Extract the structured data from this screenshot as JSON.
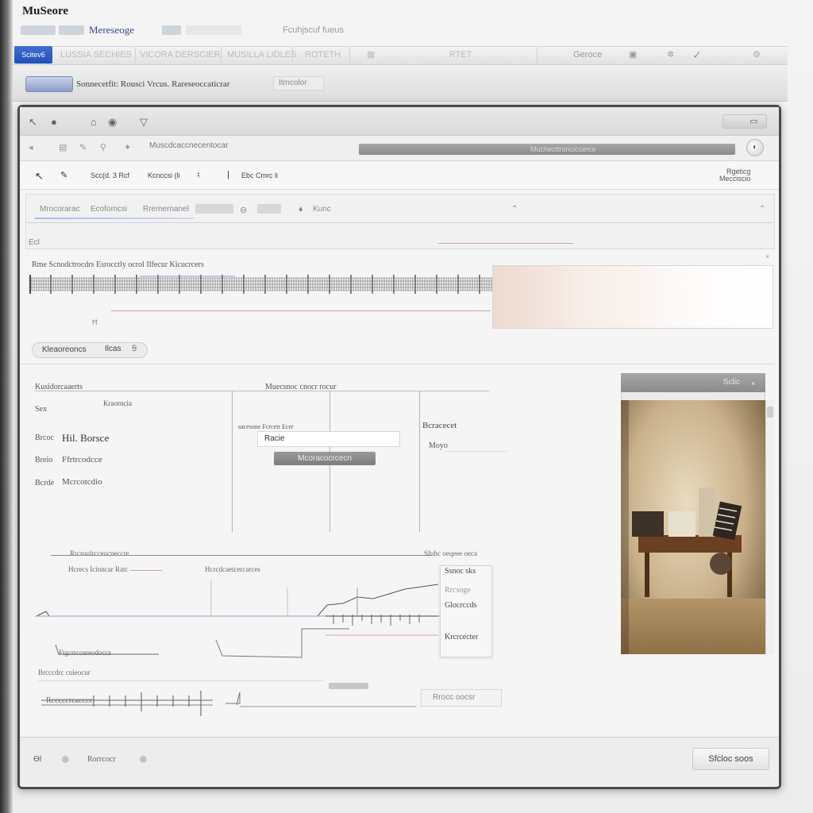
{
  "app": {
    "title": "MuSeore",
    "brand_link": "Mereseoge",
    "caption": "Fcuhjscuf fueus"
  },
  "main_toolbar": {
    "active_tab": "Scitev6",
    "items": [
      "LUSSIA SECHIES",
      "VICORA DERSCIER",
      "MUSILLA LIDLES",
      "ROTETH",
      "RTET",
      "Geroce"
    ]
  },
  "sub_toolbar": {
    "path": "Sonnecetfit: Rousci Vrcus. Rareseoccaticrar",
    "search": "Itmcolor"
  },
  "nav": {
    "url": "Muscdcaccnecentocar",
    "field": "Muchecttronciccerce",
    "go": "◐"
  },
  "format_bar": {
    "item1": "Scc(d. 3 Rcf",
    "item2": "Kcnccsi (li",
    "item3": "Ebc Cmrc li",
    "right_line1": "Rgeticg",
    "right_line2": "Mecciscio"
  },
  "score": {
    "tab1": "Mrocorarac",
    "tab2": "Ecofomcsi",
    "tab3": "Rremernanel",
    "tab4": "Kunc",
    "row_label": "Ecl",
    "measure_label": "Rme Scnodctrocdrs Esrocctly ocrol Ilfecur Kicucrcers",
    "tiny_note": "Ħ"
  },
  "measure_select": {
    "label": "Kleaoreoncs",
    "value": "Ilcas",
    "btn": "Ꞩ"
  },
  "properties": {
    "header": "Kusidorcaaerts",
    "row1_label": "Sex",
    "row1_hint": "Kraorncia",
    "row2_label": "Brcoc",
    "row2_value": "Hil. Borsce",
    "row3_label": "Breio",
    "row3_value": "Ffrtrcodcce",
    "row4_label": "Bcrde",
    "row4_value": "Mcrcotcdio",
    "col2_header": "Muecsnoc cnocr rocur",
    "col2_label": "sacesone Fcrcetr Ecre",
    "input_value": "Racie",
    "button": "Mcoracocrcecn",
    "col3_label": "Bcracecet",
    "col3_value": "Moyo"
  },
  "image_panel": {
    "header": "Sclic"
  },
  "lower": {
    "label1": "Rrcroolrcceocneccre",
    "label2": "Hcrecs Icinncar Ratc",
    "label3": "Hcrcdcaetcercarces",
    "label4": "Ftgcrrccereodoccs",
    "label5": "Brcccdrc cuieocur",
    "label6": "Rcccccrcaccce",
    "right_label": "Sfuhc oeqeee oeca",
    "field": "Rrocc oocsr",
    "popup": [
      "Ssnoc sks",
      "Rrcsoge",
      "Glocrccds",
      "Krcrcecter"
    ]
  },
  "status": {
    "item1": "Ѳŀ",
    "item2": "◎",
    "item3": "Rorrcocr",
    "item4": "◎",
    "button": "Sfcloc soos"
  }
}
